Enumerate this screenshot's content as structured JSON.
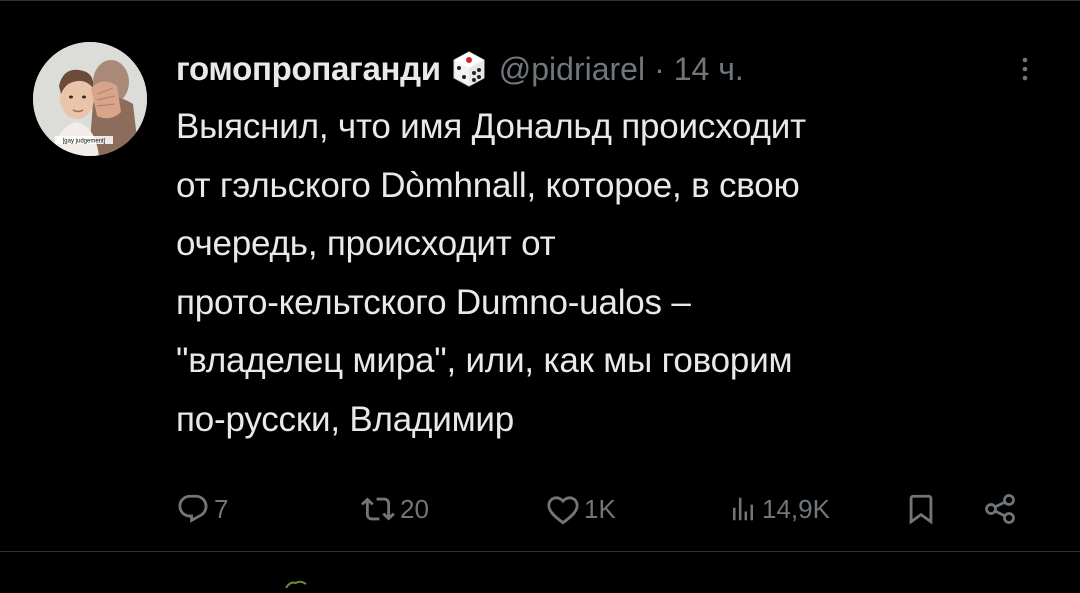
{
  "tweet": {
    "author": {
      "display_name": "гомопропаганди",
      "badge_icon": "dice-icon",
      "handle": "@pidriarel",
      "avatar_caption": "[gay judgement]"
    },
    "separator": "·",
    "time": "14 ч.",
    "text": "Выяснил, что имя Дональд происходит\nот гэльского Dòmhnall, которое, в свою\nочередь, происходит от\nпрото-кельтского Dumno-ualos –\n\"владелец мира\", или, как мы говорим\nпо-русски, Владимир",
    "actions": {
      "reply": {
        "icon": "reply-icon",
        "count": "7"
      },
      "retweet": {
        "icon": "retweet-icon",
        "count": "20"
      },
      "like": {
        "icon": "heart-icon",
        "count": "1K"
      },
      "views": {
        "icon": "views-chart-icon",
        "count": "14,9K"
      },
      "bookmark": {
        "icon": "bookmark-icon"
      },
      "share": {
        "icon": "share-icon"
      }
    }
  },
  "colors": {
    "background": "#000000",
    "text_primary": "#e7e9ea",
    "text_secondary": "#71767b",
    "divider": "#2f3336"
  }
}
